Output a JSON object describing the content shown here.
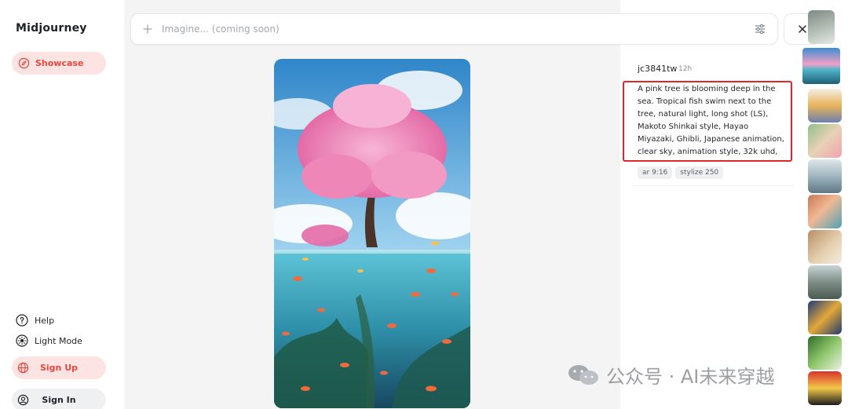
{
  "app": {
    "logo": "Midjourney"
  },
  "sidebar": {
    "showcase_label": "Showcase",
    "help_label": "Help",
    "light_mode_label": "Light Mode",
    "sign_up_label": "Sign Up",
    "sign_in_label": "Sign In"
  },
  "search": {
    "placeholder": "Imagine... (coming soon)"
  },
  "post": {
    "author": "jc3841tw",
    "time": "12h",
    "prompt": "A pink tree is blooming deep in the sea. Tropical fish swim next to the tree, natural light, long shot (LS), Makoto Shinkai style, Hayao Miyazaki, Ghibli, Japanese animation, clear sky, animation style, 32k uhd,",
    "params": [
      "ar 9:16",
      "stylize 250"
    ]
  },
  "watermark": {
    "text": "公众号 · AI未来穿越"
  },
  "colors": {
    "accent": "#e5483e",
    "accent_bg": "#fde4e3",
    "highlight_border": "#e0262c"
  },
  "icons": {
    "showcase": "compass-icon",
    "help": "help-circle-icon",
    "light_mode": "sun-icon",
    "sign_up": "globe-icon",
    "sign_in": "user-circle-icon",
    "search_add": "plus-icon",
    "search_filter": "sliders-icon",
    "close": "close-icon"
  }
}
